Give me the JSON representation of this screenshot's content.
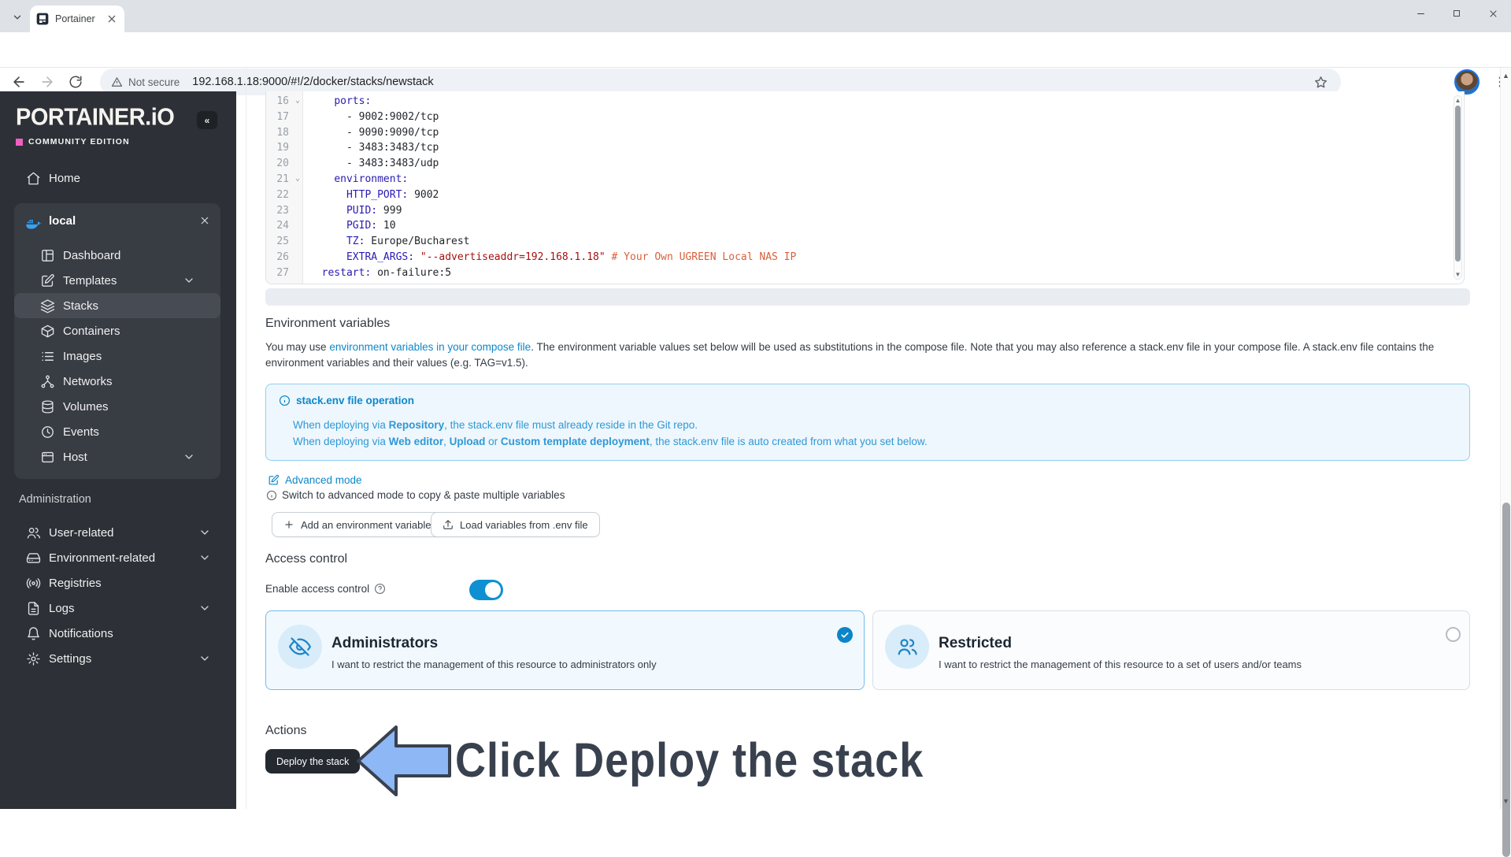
{
  "browser": {
    "tab_title": "Portainer",
    "not_secure": "Not secure",
    "url": "192.168.1.18:9000/#!/2/docker/stacks/newstack"
  },
  "sidebar": {
    "logo": "PORTAINER.iO",
    "edition": "COMMUNITY EDITION",
    "collapse": "«",
    "home_label": "Home",
    "environment": {
      "name": "local",
      "icon": "docker-whale-icon"
    },
    "items": [
      {
        "label": "Dashboard",
        "icon": "dashboard-icon",
        "chevron": false,
        "active": false
      },
      {
        "label": "Templates",
        "icon": "templates-icon",
        "chevron": true,
        "active": false
      },
      {
        "label": "Stacks",
        "icon": "stacks-icon",
        "chevron": false,
        "active": true
      },
      {
        "label": "Containers",
        "icon": "containers-icon",
        "chevron": false,
        "active": false
      },
      {
        "label": "Images",
        "icon": "images-icon",
        "chevron": false,
        "active": false
      },
      {
        "label": "Networks",
        "icon": "networks-icon",
        "chevron": false,
        "active": false
      },
      {
        "label": "Volumes",
        "icon": "volumes-icon",
        "chevron": false,
        "active": false
      },
      {
        "label": "Events",
        "icon": "events-icon",
        "chevron": false,
        "active": false
      },
      {
        "label": "Host",
        "icon": "host-icon",
        "chevron": true,
        "active": false
      }
    ],
    "administration_label": "Administration",
    "admin_items": [
      {
        "label": "User-related",
        "icon": "users-icon",
        "chevron": true
      },
      {
        "label": "Environment-related",
        "icon": "environments-icon",
        "chevron": true
      },
      {
        "label": "Registries",
        "icon": "registries-icon",
        "chevron": false
      },
      {
        "label": "Logs",
        "icon": "logs-icon",
        "chevron": true
      },
      {
        "label": "Notifications",
        "icon": "notifications-icon",
        "chevron": false
      },
      {
        "label": "Settings",
        "icon": "settings-icon",
        "chevron": true
      }
    ]
  },
  "editor": {
    "lines": [
      {
        "n": "16",
        "fold": true,
        "parts": [
          [
            "plain",
            "    "
          ],
          [
            "key",
            "ports:"
          ]
        ]
      },
      {
        "n": "17",
        "fold": false,
        "parts": [
          [
            "plain",
            "      - 9002:9002/tcp"
          ]
        ]
      },
      {
        "n": "18",
        "fold": false,
        "parts": [
          [
            "plain",
            "      - 9090:9090/tcp"
          ]
        ]
      },
      {
        "n": "19",
        "fold": false,
        "parts": [
          [
            "plain",
            "      - 3483:3483/tcp"
          ]
        ]
      },
      {
        "n": "20",
        "fold": false,
        "parts": [
          [
            "plain",
            "      - 3483:3483/udp"
          ]
        ]
      },
      {
        "n": "21",
        "fold": true,
        "parts": [
          [
            "plain",
            "    "
          ],
          [
            "key",
            "environment:"
          ]
        ]
      },
      {
        "n": "22",
        "fold": false,
        "parts": [
          [
            "plain",
            "      "
          ],
          [
            "key",
            "HTTP_PORT:"
          ],
          [
            "plain",
            " 9002"
          ]
        ]
      },
      {
        "n": "23",
        "fold": false,
        "parts": [
          [
            "plain",
            "      "
          ],
          [
            "key",
            "PUID:"
          ],
          [
            "plain",
            " 999"
          ]
        ]
      },
      {
        "n": "24",
        "fold": false,
        "parts": [
          [
            "plain",
            "      "
          ],
          [
            "key",
            "PGID:"
          ],
          [
            "plain",
            " 10"
          ]
        ]
      },
      {
        "n": "25",
        "fold": false,
        "parts": [
          [
            "plain",
            "      "
          ],
          [
            "key",
            "TZ:"
          ],
          [
            "plain",
            " Europe/Bucharest"
          ]
        ]
      },
      {
        "n": "26",
        "fold": false,
        "parts": [
          [
            "plain",
            "      "
          ],
          [
            "key",
            "EXTRA_ARGS:"
          ],
          [
            "plain",
            " "
          ],
          [
            "str",
            "\"--advertiseaddr=192.168.1.18\""
          ],
          [
            "plain",
            " "
          ],
          [
            "com",
            "# Your Own UGREEN Local NAS IP"
          ]
        ]
      },
      {
        "n": "27",
        "fold": false,
        "parts": [
          [
            "plain",
            "  "
          ],
          [
            "key",
            "restart:"
          ],
          [
            "plain",
            " on-failure:5"
          ]
        ]
      }
    ]
  },
  "env_vars": {
    "heading": "Environment variables",
    "paragraph": [
      [
        "t",
        "You may use "
      ],
      [
        "a",
        "environment variables in your compose file"
      ],
      [
        "t",
        ". The environment variable values set below will be used as substitutions in the compose file. Note that you may also reference a stack.env file in your compose file. A stack.env file contains the environment variables and their values (e.g. TAG=v1.5)."
      ]
    ],
    "infobox": {
      "title": "stack.env file operation",
      "line1": [
        [
          "t",
          "When deploying via "
        ],
        [
          "b",
          "Repository"
        ],
        [
          "t",
          ", the stack.env file must already reside in the Git repo."
        ]
      ],
      "line2": [
        [
          "t",
          "When deploying via "
        ],
        [
          "b",
          "Web editor"
        ],
        [
          "t",
          ", "
        ],
        [
          "b",
          "Upload"
        ],
        [
          "t",
          " or "
        ],
        [
          "b",
          "Custom template deployment"
        ],
        [
          "t",
          ", the stack.env file is auto created from what you set below."
        ]
      ]
    },
    "advanced_mode": "Advanced mode",
    "advanced_hint": "Switch to advanced mode to copy & paste multiple variables",
    "add_button": "Add an environment variable",
    "load_button": "Load variables from .env file"
  },
  "access_control": {
    "heading": "Access control",
    "toggle_label": "Enable access control",
    "toggle_on": true,
    "options": [
      {
        "title": "Administrators",
        "desc": "I want to restrict the management of this resource to administrators only",
        "selected": true
      },
      {
        "title": "Restricted",
        "desc": "I want to restrict the management of this resource to a set of users and/or teams",
        "selected": false
      }
    ]
  },
  "actions": {
    "heading": "Actions",
    "deploy_button": "Deploy the stack",
    "annotation": "Click Deploy the stack"
  },
  "colors": {
    "accent_blue": "#0d87ca",
    "brand_pink": "#ef5fc0",
    "sidebar_bg": "#2d3036",
    "toggle_blue": "#0e90d2",
    "comment_orange": "#d9603b",
    "string_red": "#a51111",
    "key_indigo": "#2a1bb0",
    "annotation_arrow_fill": "#8db7f5"
  }
}
